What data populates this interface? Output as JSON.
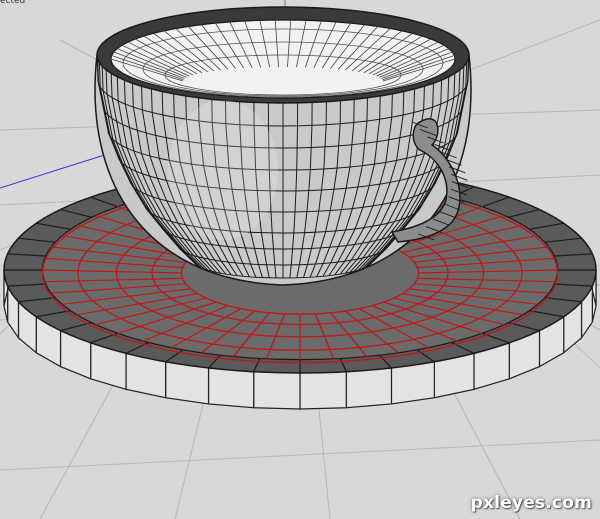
{
  "viewport": {
    "status_label": "ected",
    "background": "#d8d8d8",
    "grid_color": "#b8b8b8",
    "axis_colors": {
      "x": "#ff5050",
      "y": "#2bb52b",
      "z": "#3b3bd0"
    }
  },
  "model": {
    "cup": {
      "object": "teacup",
      "wire_color": "#1a1a1a",
      "fill_color": "#c9c9c9",
      "inner_color": "#f2f2f2"
    },
    "saucer": {
      "object": "saucer",
      "top_color": "#6b6b6b",
      "rim_color": "#5a5a5a",
      "edge_color": "#e3e3e3",
      "selected_edge_color": "#c01818"
    },
    "handle": {
      "object": "cup-handle"
    }
  },
  "watermark": {
    "text": "pxleyes.com"
  }
}
